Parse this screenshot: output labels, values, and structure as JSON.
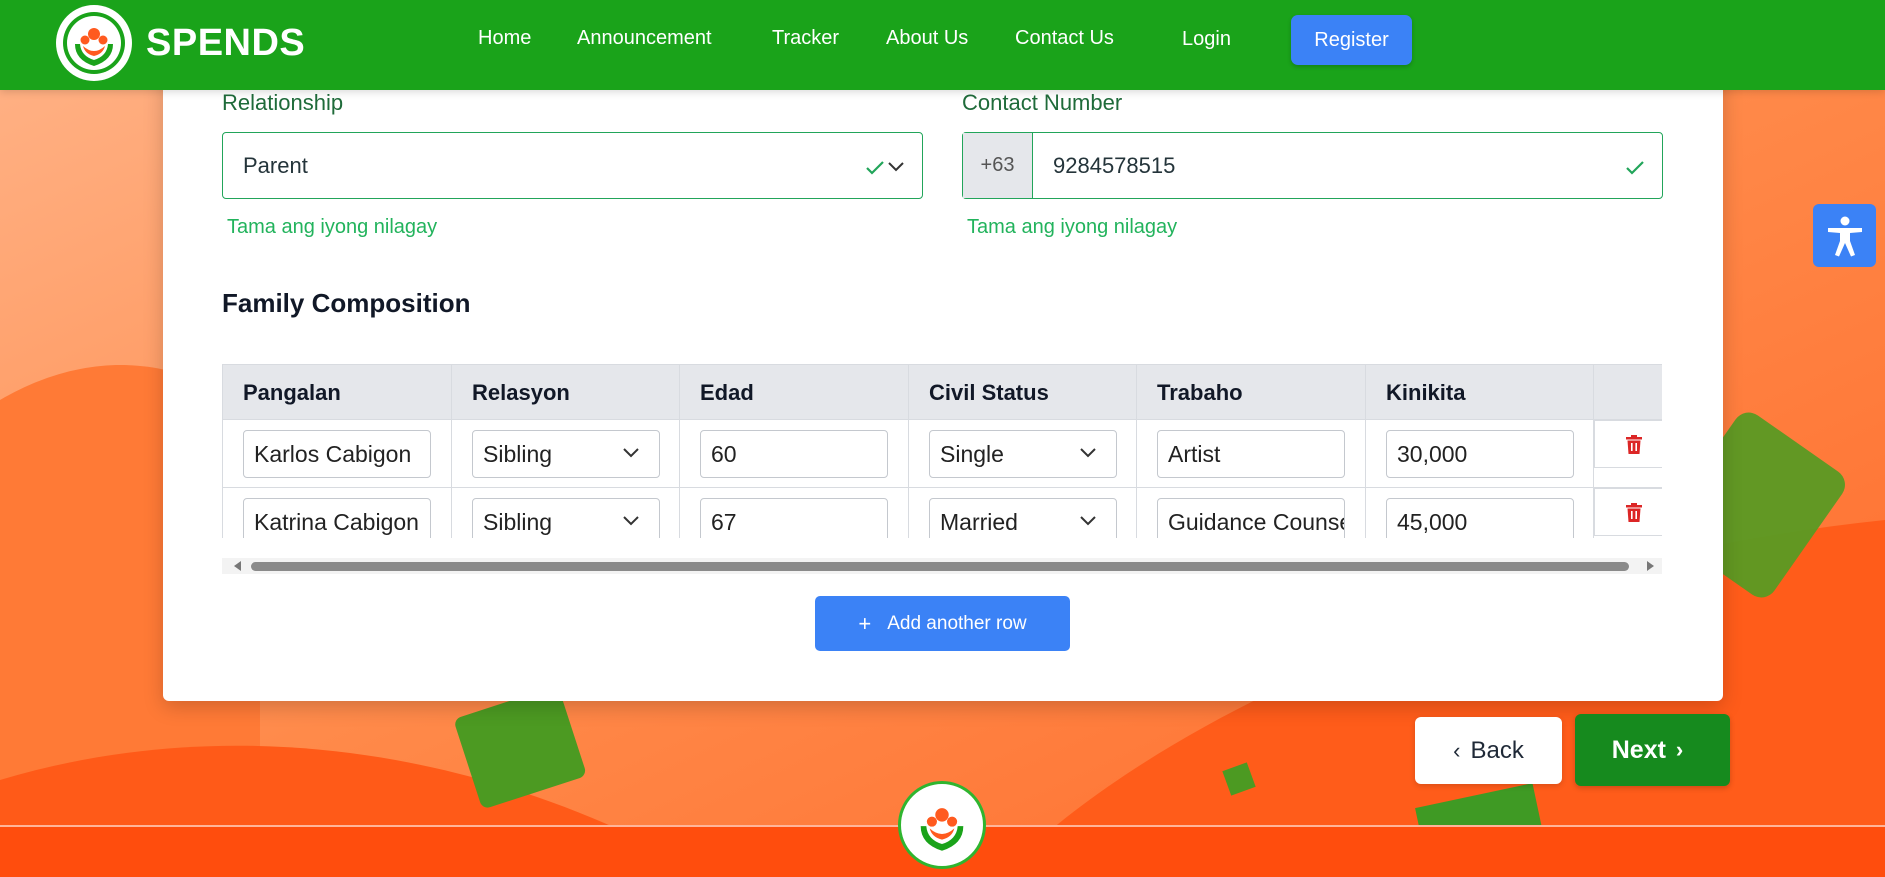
{
  "brand": {
    "name": "SPENDS",
    "logo_icon": "family-hands-logo-icon"
  },
  "nav": {
    "links": [
      "Home",
      "Announcement",
      "Tracker",
      "About Us",
      "Contact Us",
      "Login"
    ],
    "register_label": "Register"
  },
  "form": {
    "relationship": {
      "label": "Relationship",
      "value": "Parent",
      "validation": "Tama ang iyong nilagay"
    },
    "contact": {
      "label": "Contact Number",
      "prefix": "+63",
      "value": "9284578515",
      "validation": "Tama ang iyong nilagay"
    }
  },
  "family": {
    "title": "Family Composition",
    "columns": [
      "Pangalan",
      "Relasyon",
      "Edad",
      "Civil Status",
      "Trabaho",
      "Kinikita"
    ],
    "rows": [
      {
        "name": "Karlos Cabigon",
        "relation": "Sibling",
        "age": "60",
        "civil_status": "Single",
        "job": "Artist",
        "income": "30,000"
      },
      {
        "name": "Katrina Cabigon",
        "relation": "Sibling",
        "age": "67",
        "civil_status": "Married",
        "job": "Guidance Counselor",
        "income": "45,000"
      }
    ],
    "add_row_label": "Add another row"
  },
  "footer": {
    "back_label": "Back",
    "next_label": "Next"
  },
  "colors": {
    "nav_green": "#1aa31a",
    "accent_blue": "#3b82f6",
    "valid_green": "#22b35c",
    "next_green": "#168a1e",
    "delete_red": "#dc2626",
    "footer_orange": "#ff4d0d"
  }
}
